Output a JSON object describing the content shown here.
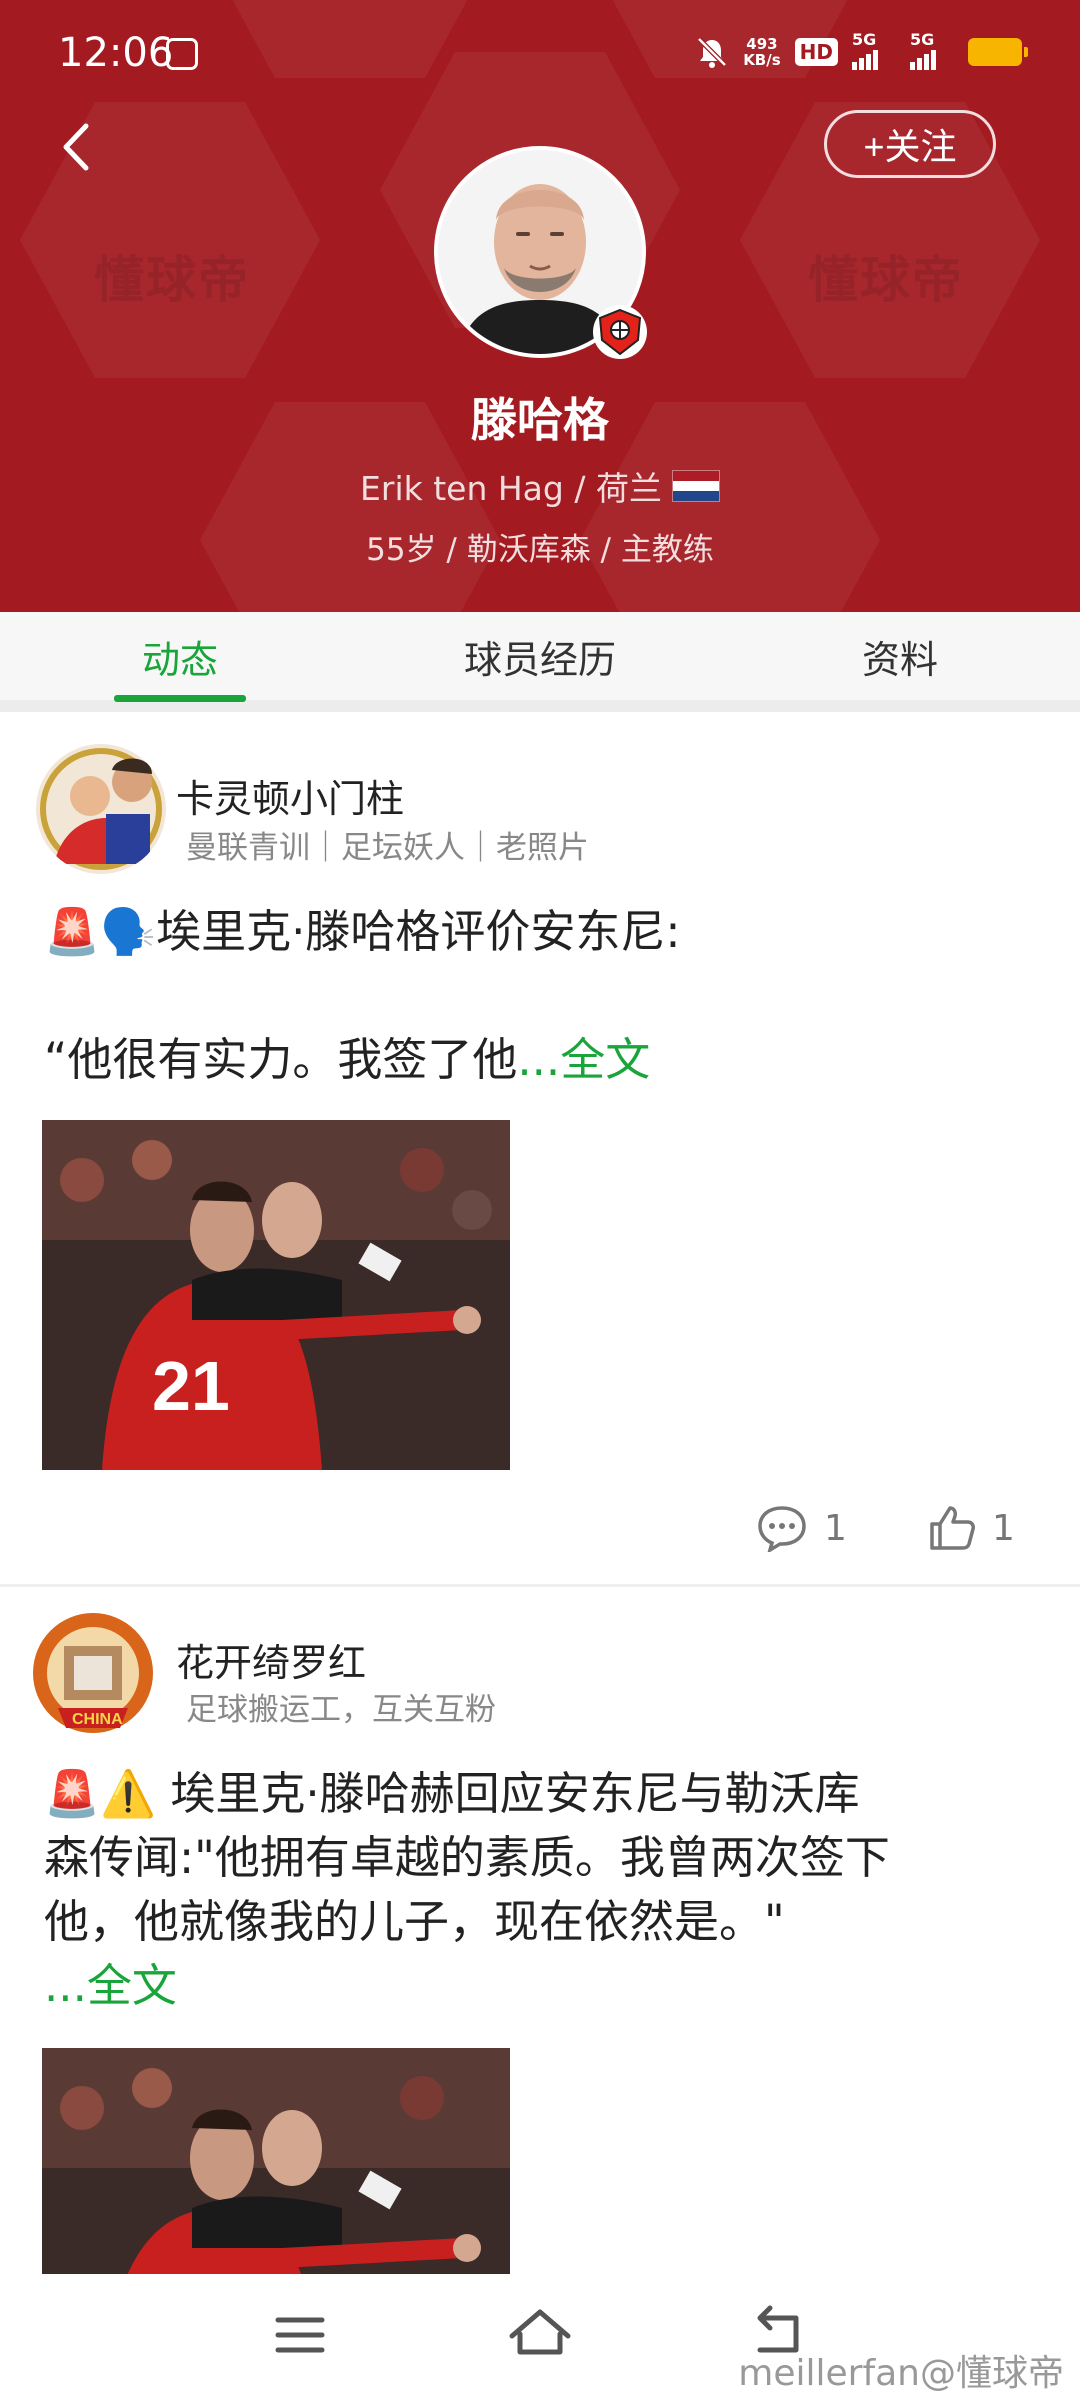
{
  "status_bar": {
    "time": "12:06",
    "net_speed_value": "493",
    "net_speed_unit": "KB/s",
    "hd_label": "HD",
    "signal1_label": "5G",
    "signal2_label": "5G"
  },
  "header": {
    "follow_label": "+关注",
    "watermark_text": "懂球帝",
    "coach_name": "滕哈格",
    "coach_en_name": "Erik ten Hag / 荷兰",
    "coach_meta": "55岁 / 勒沃库森 / 主教练"
  },
  "tabs": [
    {
      "label": "动态",
      "active": true
    },
    {
      "label": "球员经历",
      "active": false
    },
    {
      "label": "资料",
      "active": false
    }
  ],
  "posts": [
    {
      "author": "卡灵顿小门柱",
      "tags": "曼联青训｜足坛妖人｜老照片",
      "emoji": "🚨🗣️",
      "text_line1": "埃里克·滕哈格评价安东尼:",
      "text_line2": "“他很有实力。我签了他",
      "more_label": "...全文",
      "comments": "1",
      "likes": "1"
    },
    {
      "author": "花开绮罗红",
      "tags": "足球搬运工，互关互粉",
      "emoji": "🚨⚠️",
      "text_line1": " 埃里克·滕哈赫回应安东尼与勒沃库",
      "text_line2": "森传闻:\"他拥有卓越的素质。我曾两次签下",
      "text_line3": "他，他就像我的儿子，现在依然是。\"",
      "more_label": "...全文"
    }
  ],
  "footer": {
    "watermark": "meillerfan@懂球帝"
  },
  "colors": {
    "header_bg": "#a31a20",
    "accent_green": "#1aa53a",
    "battery": "#f7b500"
  },
  "icons": [
    "back-arrow-icon",
    "mute-icon",
    "comment-icon",
    "thumbs-up-icon",
    "menu-icon",
    "home-icon",
    "back-nav-icon"
  ]
}
